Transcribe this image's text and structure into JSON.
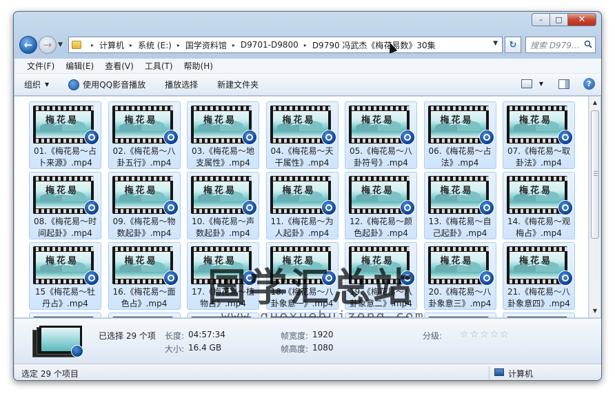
{
  "window": {
    "caption_buttons": {
      "minimize": "–",
      "maximize": "□",
      "close": "✕"
    }
  },
  "nav": {
    "back_glyph": "←",
    "forward_glyph": "→",
    "history_glyph": "▼",
    "breadcrumb": [
      "计算机",
      "系统 (E:)",
      "国学资料馆",
      "D9701-D9800",
      "D9790 冯武杰《梅花易数》30集"
    ],
    "separator": "▸",
    "refresh_glyph": "↻",
    "search_placeholder": "搜索 D979...",
    "address_dropdown": "▼"
  },
  "menubar": {
    "items": [
      "文件(F)",
      "编辑(E)",
      "查看(V)",
      "工具(T)",
      "帮助(H)"
    ]
  },
  "toolbar": {
    "organize": "组织",
    "play_with_qq": "使用QQ影音播放",
    "play_selection": "播放选择",
    "new_folder": "新建文件夹",
    "caret": "▼",
    "help": "?"
  },
  "files": [
    {
      "name": "01.《梅花易～占卜来源》.mp4"
    },
    {
      "name": "02.《梅花易～八卦五行》.mp4"
    },
    {
      "name": "03.《梅花易～地支属性》.mp4"
    },
    {
      "name": "04.《梅花易～天干属性》.mp4"
    },
    {
      "name": "05.《梅花易～八卦符号》.mp4"
    },
    {
      "name": "06.《梅花易～占法》.mp4"
    },
    {
      "name": "07.《梅花易～取卦法》.mp4"
    },
    {
      "name": "08.《梅花易～时间起卦》.mp4"
    },
    {
      "name": "09.《梅花易～物数起卦》.mp4"
    },
    {
      "name": "10.《梅花易～声数起卦》.mp4"
    },
    {
      "name": "11.《梅花易～为人起卦》.mp4"
    },
    {
      "name": "12.《梅花易～颜色起卦》.mp4"
    },
    {
      "name": "13.《梅花易～自己起卦》.mp4"
    },
    {
      "name": "14.《梅花易～观梅占》.mp4"
    },
    {
      "name": "15《梅花易～牡丹占》.mp4"
    },
    {
      "name": "16.《梅花易～面色占》.mp4"
    },
    {
      "name": "17.《梅花易～植物占》.mp4"
    },
    {
      "name": "18.《梅花易～八卦象意一》.mp4"
    },
    {
      "name": "19.《梅花易～八卦象意二》.mp4"
    },
    {
      "name": "20.《梅花易～八卦象意三》.mp4"
    },
    {
      "name": "21.《梅花易～八卦象意四》.mp4"
    },
    {
      "name": ""
    },
    {
      "name": ""
    },
    {
      "name": ""
    },
    {
      "name": ""
    },
    {
      "name": ""
    },
    {
      "name": ""
    },
    {
      "name": ""
    }
  ],
  "thumbnail_calligraphy": "梅花易",
  "scrollbar": {
    "up": "▲",
    "down": "▼"
  },
  "details": {
    "selected": "已选择 29 个项",
    "length_label": "长度:",
    "length_value": "04:57:34",
    "size_label": "大小:",
    "size_value": "16.4 GB",
    "frame_width_label": "帧宽度:",
    "frame_width_value": "1920",
    "frame_height_label": "帧高度:",
    "frame_height_value": "1080",
    "rating_label": "分级:",
    "rating_stars": 0,
    "rating_max": 5,
    "star_glyph": "☆"
  },
  "status": {
    "left": "选定 29 个项目",
    "right": "计算机"
  },
  "watermark": {
    "text": "国学汇总站",
    "url": "www.guoxuehuizong.com"
  },
  "colors": {
    "accent": "#1c57a6",
    "selection_bg": "#cfe4fb",
    "selection_border": "#a9cdf3"
  }
}
